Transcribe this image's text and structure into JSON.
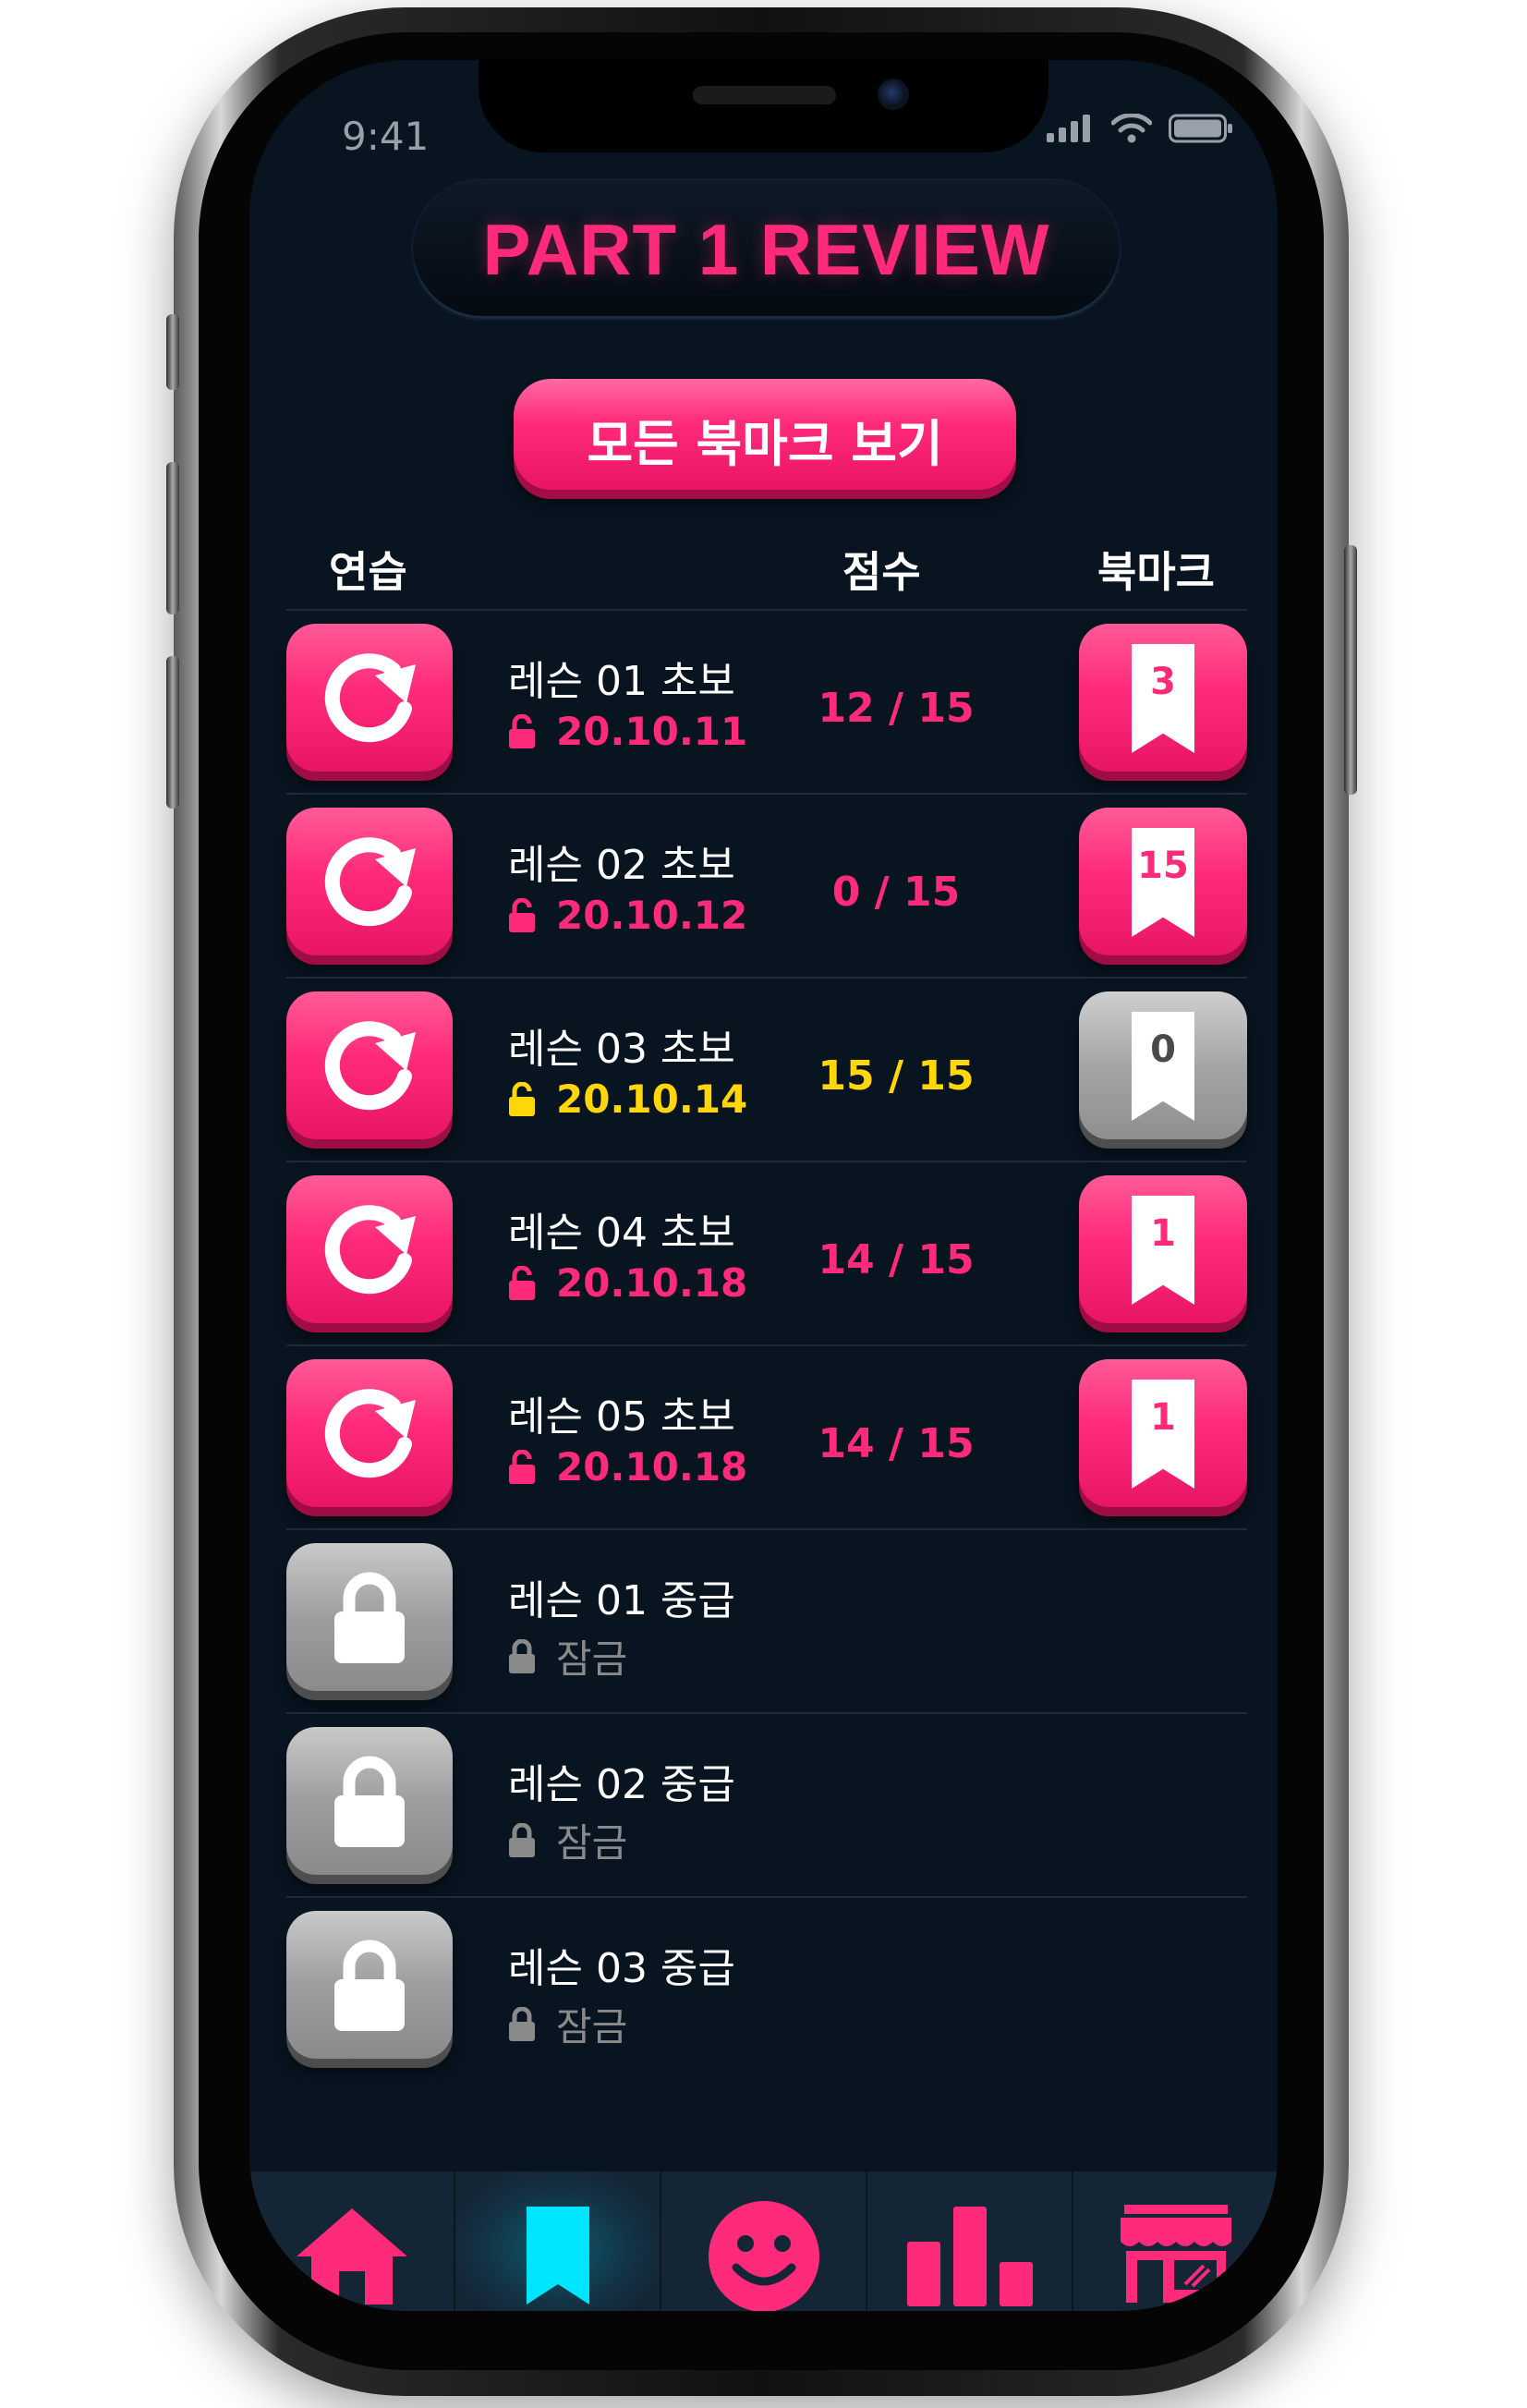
{
  "status": {
    "time": "9:41"
  },
  "header": {
    "title": "PART 1 REVIEW"
  },
  "actions": {
    "view_all_bookmarks": "모든 북마크 보기"
  },
  "columns": {
    "practice": "연습",
    "score": "점수",
    "bookmark": "북마크"
  },
  "colors": {
    "accent": "#ff2a7a",
    "gold": "#ffd60a",
    "locked": "#8a8a8a",
    "active_tab": "#00e5ff",
    "background": "#081420"
  },
  "lessons": [
    {
      "name": "레슨 01 초보",
      "date": "20.10.11",
      "score": "12 / 15",
      "bookmarks": "3",
      "state": "unlocked",
      "highlight": "pink",
      "bookmark_style": "pink"
    },
    {
      "name": "레슨 02 초보",
      "date": "20.10.12",
      "score": "0 / 15",
      "bookmarks": "15",
      "state": "unlocked",
      "highlight": "pink",
      "bookmark_style": "pink"
    },
    {
      "name": "레슨 03 초보",
      "date": "20.10.14",
      "score": "15 / 15",
      "bookmarks": "0",
      "state": "unlocked",
      "highlight": "gold",
      "bookmark_style": "gray"
    },
    {
      "name": "레슨 04 초보",
      "date": "20.10.18",
      "score": "14 / 15",
      "bookmarks": "1",
      "state": "unlocked",
      "highlight": "pink",
      "bookmark_style": "pink"
    },
    {
      "name": "레슨 05 초보",
      "date": "20.10.18",
      "score": "14 / 15",
      "bookmarks": "1",
      "state": "unlocked",
      "highlight": "pink",
      "bookmark_style": "pink"
    },
    {
      "name": "레슨 01 중급",
      "date": "잠금",
      "state": "locked"
    },
    {
      "name": "레슨 02 중급",
      "date": "잠금",
      "state": "locked"
    },
    {
      "name": "레슨 03 중급",
      "date": "잠금",
      "state": "locked"
    }
  ],
  "tabbar": {
    "items": [
      {
        "icon": "home-icon",
        "active": false
      },
      {
        "icon": "bookmark-icon",
        "active": true
      },
      {
        "icon": "smiley-icon",
        "active": false
      },
      {
        "icon": "bar-chart-icon",
        "active": false
      },
      {
        "icon": "store-icon",
        "active": false
      }
    ]
  }
}
